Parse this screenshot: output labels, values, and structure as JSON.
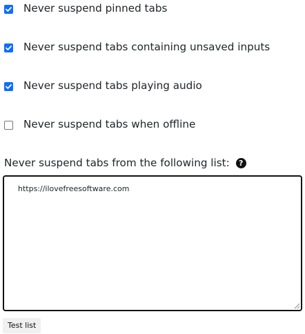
{
  "options": [
    {
      "label": "Never suspend pinned tabs",
      "checked": true
    },
    {
      "label": "Never suspend tabs containing unsaved inputs",
      "checked": true
    },
    {
      "label": "Never suspend tabs playing audio",
      "checked": true
    },
    {
      "label": "Never suspend tabs when offline",
      "checked": false
    }
  ],
  "whitelist": {
    "label": "Never suspend tabs from the following list:",
    "help_icon": "question-circle-icon",
    "value": "https://ilovefreesoftware.com"
  },
  "test_button_label": "Test list",
  "colors": {
    "accent": "#0d6efd",
    "text": "#212529",
    "border": "#111111",
    "button_bg": "#f0f0f0"
  }
}
